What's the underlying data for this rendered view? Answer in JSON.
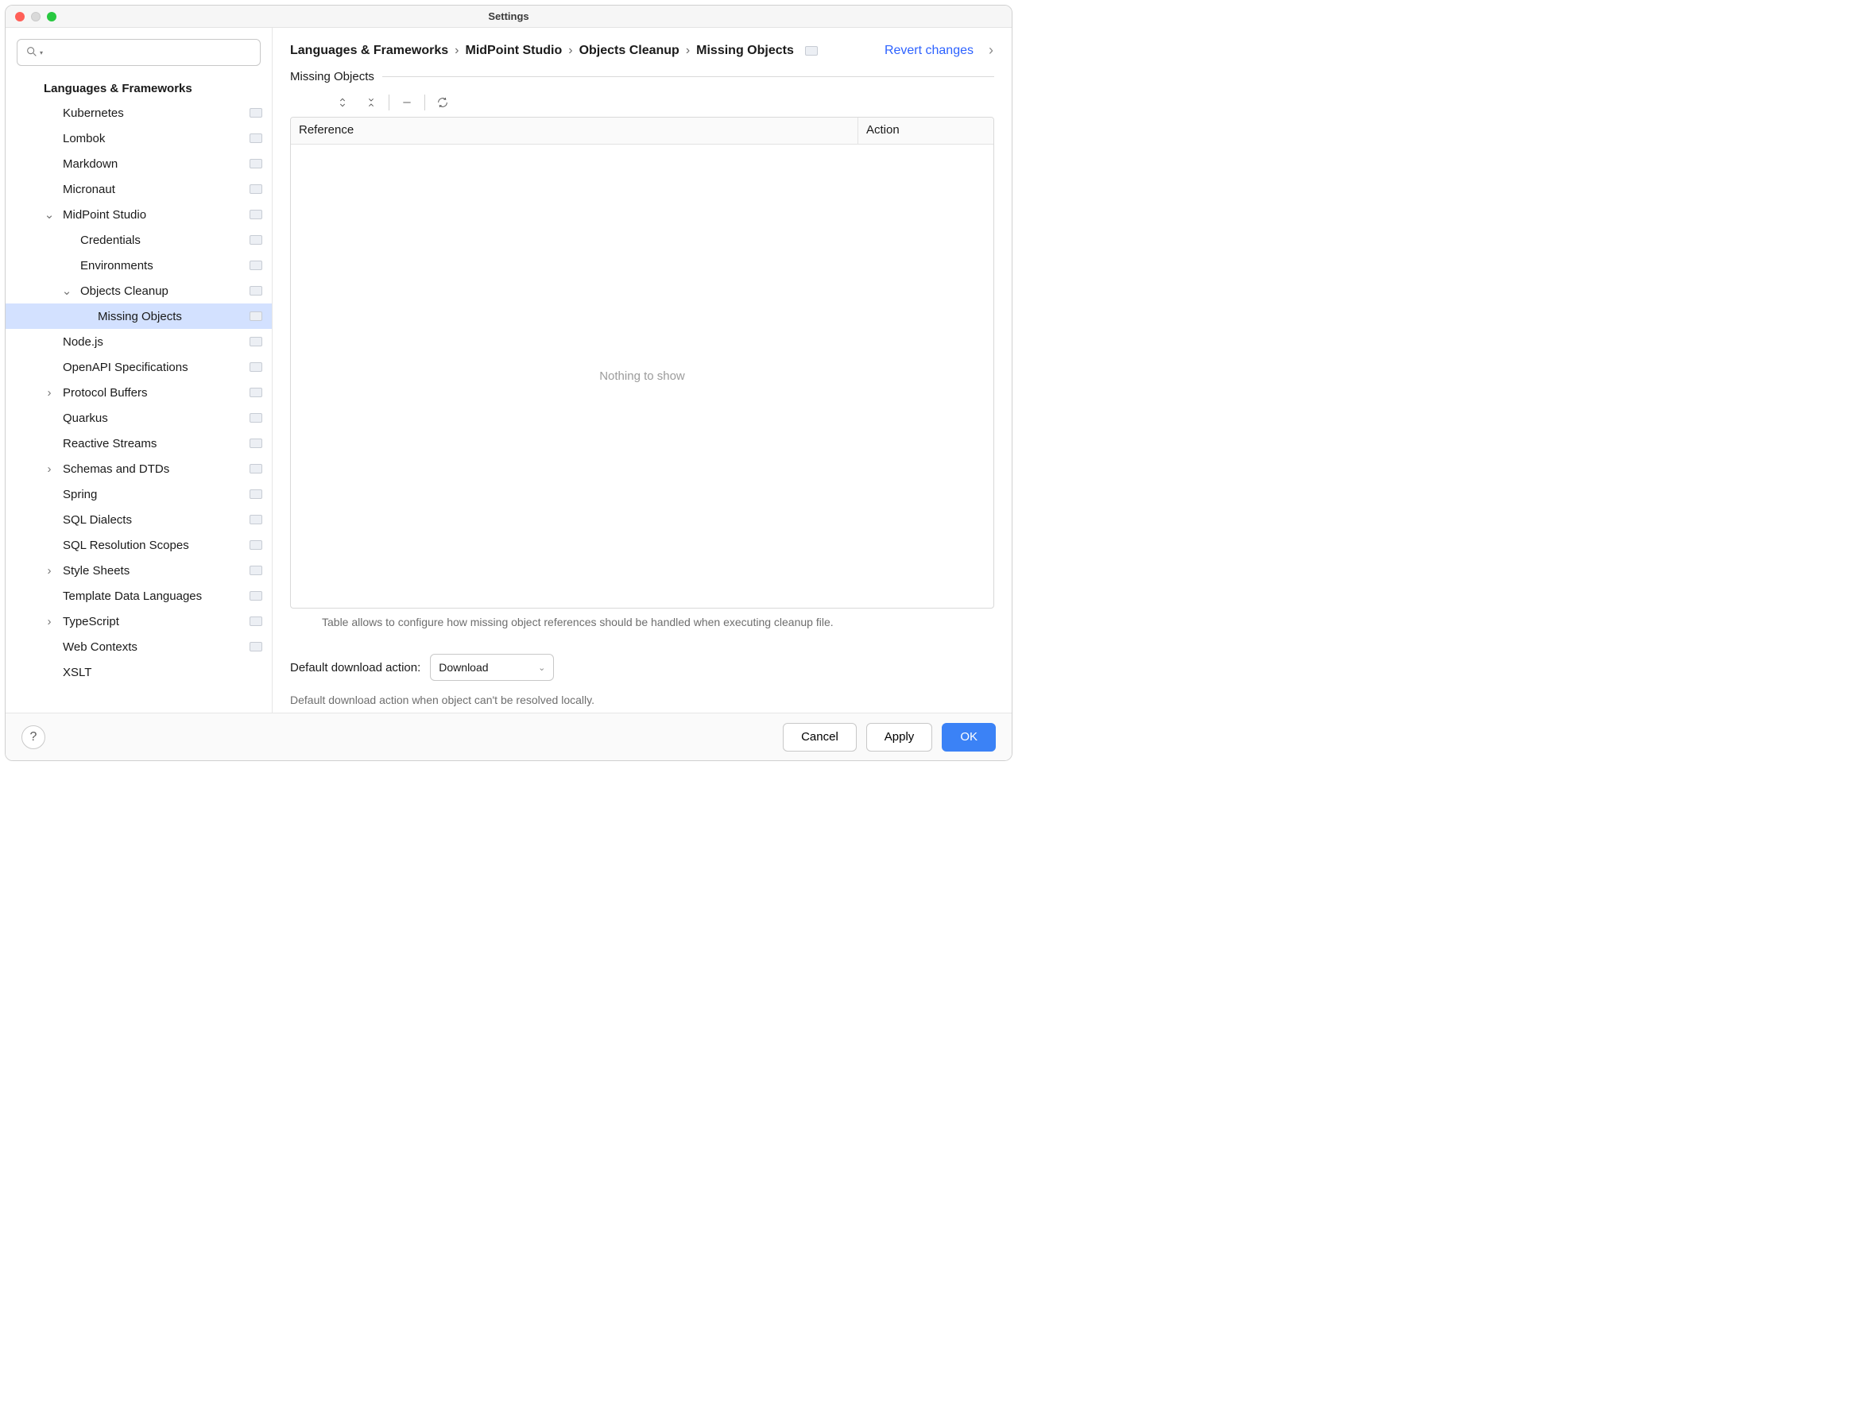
{
  "window": {
    "title": "Settings"
  },
  "search": {
    "placeholder": ""
  },
  "sidebar": {
    "header": "Languages & Frameworks",
    "items": [
      {
        "label": "Kubernetes",
        "depth": 1,
        "scope": true,
        "chevron": ""
      },
      {
        "label": "Lombok",
        "depth": 1,
        "scope": true,
        "chevron": ""
      },
      {
        "label": "Markdown",
        "depth": 1,
        "scope": true,
        "chevron": ""
      },
      {
        "label": "Micronaut",
        "depth": 1,
        "scope": true,
        "chevron": ""
      },
      {
        "label": "MidPoint Studio",
        "depth": 1,
        "scope": true,
        "chevron": "down"
      },
      {
        "label": "Credentials",
        "depth": 2,
        "scope": true,
        "chevron": ""
      },
      {
        "label": "Environments",
        "depth": 2,
        "scope": true,
        "chevron": ""
      },
      {
        "label": "Objects Cleanup",
        "depth": 2,
        "scope": true,
        "chevron": "down"
      },
      {
        "label": "Missing Objects",
        "depth": 3,
        "scope": true,
        "chevron": "",
        "selected": true
      },
      {
        "label": "Node.js",
        "depth": 1,
        "scope": true,
        "chevron": ""
      },
      {
        "label": "OpenAPI Specifications",
        "depth": 1,
        "scope": true,
        "chevron": ""
      },
      {
        "label": "Protocol Buffers",
        "depth": 1,
        "scope": true,
        "chevron": "right"
      },
      {
        "label": "Quarkus",
        "depth": 1,
        "scope": true,
        "chevron": ""
      },
      {
        "label": "Reactive Streams",
        "depth": 1,
        "scope": true,
        "chevron": ""
      },
      {
        "label": "Schemas and DTDs",
        "depth": 1,
        "scope": true,
        "chevron": "right"
      },
      {
        "label": "Spring",
        "depth": 1,
        "scope": true,
        "chevron": ""
      },
      {
        "label": "SQL Dialects",
        "depth": 1,
        "scope": true,
        "chevron": ""
      },
      {
        "label": "SQL Resolution Scopes",
        "depth": 1,
        "scope": true,
        "chevron": ""
      },
      {
        "label": "Style Sheets",
        "depth": 1,
        "scope": true,
        "chevron": "right"
      },
      {
        "label": "Template Data Languages",
        "depth": 1,
        "scope": true,
        "chevron": ""
      },
      {
        "label": "TypeScript",
        "depth": 1,
        "scope": true,
        "chevron": "right"
      },
      {
        "label": "Web Contexts",
        "depth": 1,
        "scope": true,
        "chevron": ""
      },
      {
        "label": "XSLT",
        "depth": 1,
        "scope": false,
        "chevron": ""
      }
    ]
  },
  "main": {
    "breadcrumb": [
      "Languages & Frameworks",
      "MidPoint Studio",
      "Objects Cleanup",
      "Missing Objects"
    ],
    "revert_label": "Revert changes",
    "section_title": "Missing Objects",
    "table": {
      "columns": {
        "reference": "Reference",
        "action": "Action"
      },
      "placeholder": "Nothing to show",
      "description": "Table allows to configure how missing object references should be handled when executing cleanup file."
    },
    "option": {
      "label": "Default download action:",
      "value": "Download",
      "description": "Default download action when object can't be resolved locally."
    }
  },
  "footer": {
    "cancel": "Cancel",
    "apply": "Apply",
    "ok": "OK"
  }
}
